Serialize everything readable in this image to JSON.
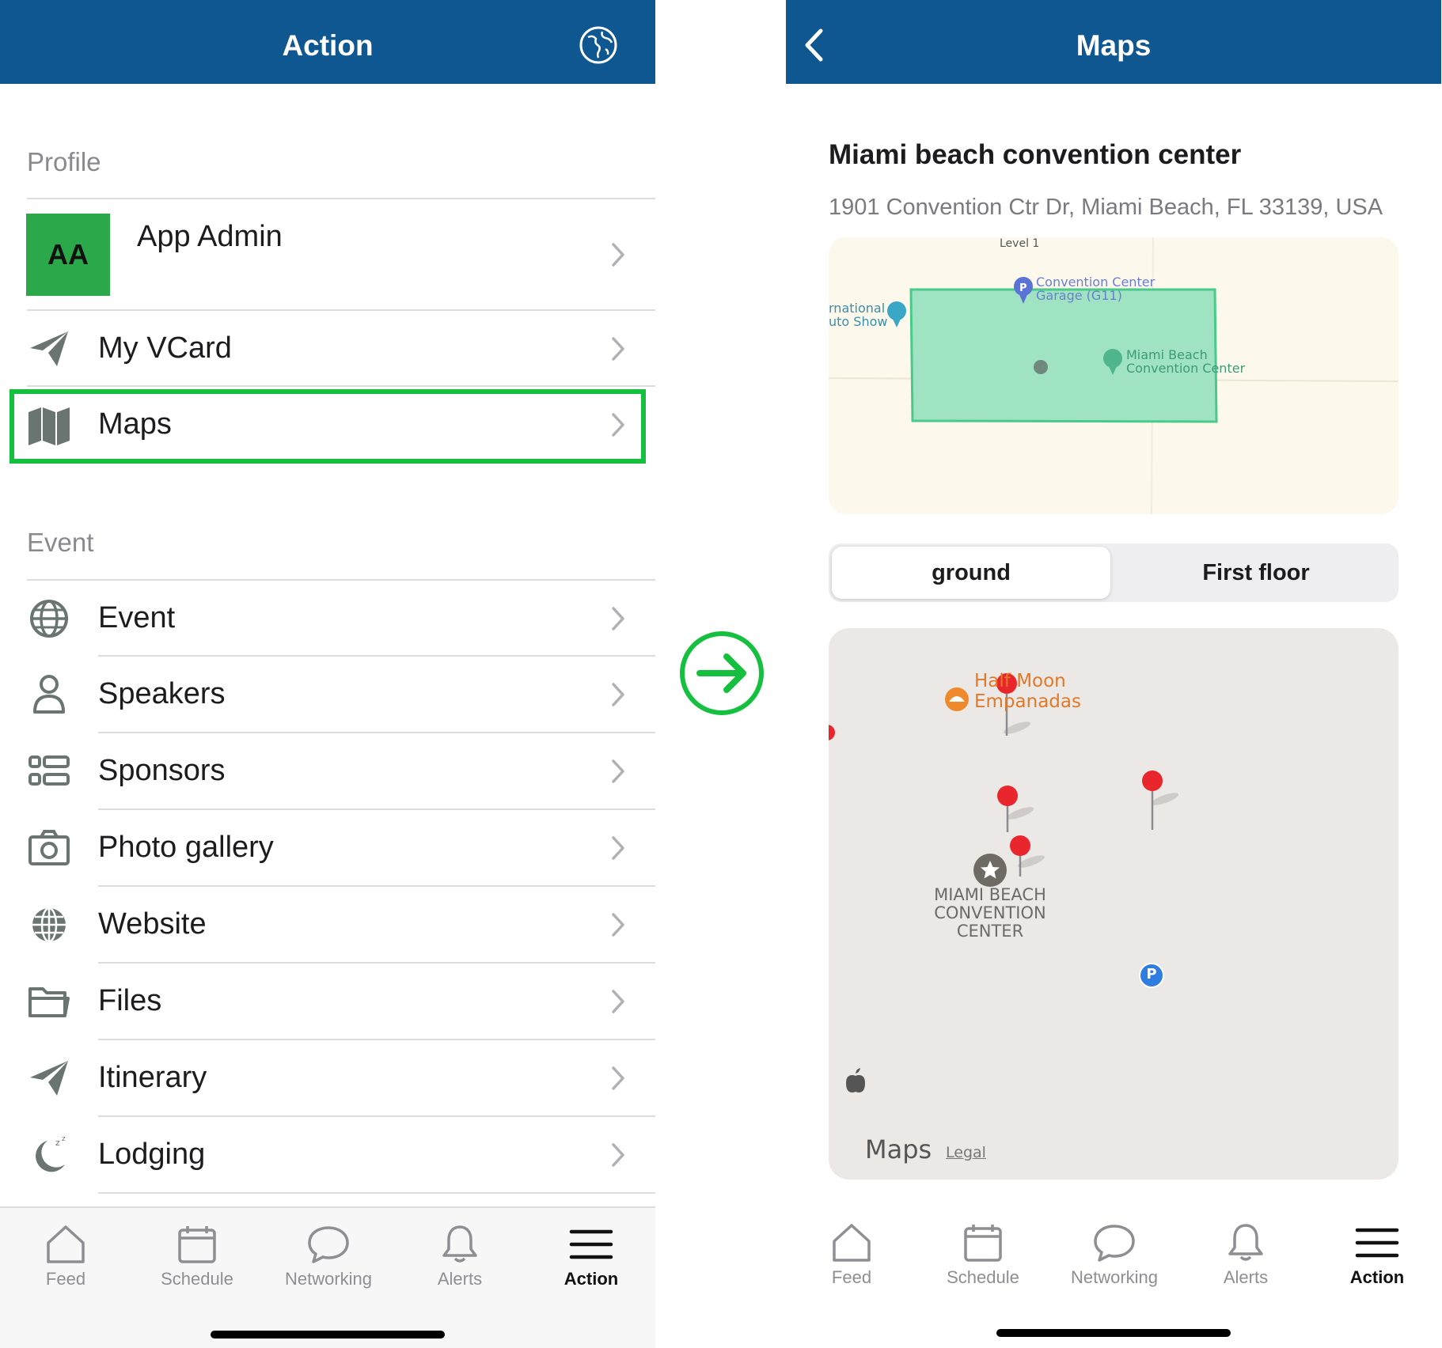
{
  "left": {
    "header": {
      "title": "Action",
      "icon": "globe-icon"
    },
    "profile_section": "Profile",
    "profile": {
      "initials": "AA",
      "name": "App Admin"
    },
    "profile_items": [
      {
        "label": "My VCard",
        "icon": "paper-plane-icon"
      },
      {
        "label": "Maps",
        "icon": "map-icon",
        "highlighted": true
      }
    ],
    "event_section": "Event",
    "event_items": [
      {
        "label": "Event",
        "icon": "globe-icon"
      },
      {
        "label": "Speakers",
        "icon": "person-icon"
      },
      {
        "label": "Sponsors",
        "icon": "list-icon"
      },
      {
        "label": "Photo gallery",
        "icon": "camera-icon"
      },
      {
        "label": "Website",
        "icon": "web-globe-icon"
      },
      {
        "label": "Files",
        "icon": "folder-icon"
      },
      {
        "label": "Itinerary",
        "icon": "paper-plane-icon"
      },
      {
        "label": "Lodging",
        "icon": "moon-icon"
      }
    ]
  },
  "right": {
    "header": {
      "title": "Maps",
      "back_icon": "chevron-left-icon"
    },
    "venue": {
      "name": "Miami beach convention center",
      "address": "1901 Convention Ctr Dr, Miami Beach, FL 33139, USA"
    },
    "floorplan_labels": {
      "level": "Level 1",
      "garage_line1": "Convention Center",
      "garage_line2": "Garage (G11)",
      "intl_line1": "rnational",
      "intl_line2": "uto Show",
      "center_line1": "Miami Beach",
      "center_line2": "Convention Center"
    },
    "floors": [
      "ground",
      "First floor"
    ],
    "selected_floor": "ground",
    "map_labels": {
      "restaurant_line1": "Half Moon",
      "restaurant_line2": "Empanadas",
      "venue_line1": "MIAMI BEACH",
      "venue_line2": "CONVENTION",
      "venue_line3": "CENTER",
      "parking": "P",
      "attribution": "Maps",
      "legal": "Legal"
    }
  },
  "tabs": [
    {
      "label": "Feed",
      "icon": "home-icon"
    },
    {
      "label": "Schedule",
      "icon": "calendar-icon"
    },
    {
      "label": "Networking",
      "icon": "chat-bubble-icon"
    },
    {
      "label": "Alerts",
      "icon": "bell-icon"
    },
    {
      "label": "Action",
      "icon": "hamburger-menu-icon",
      "active": true
    }
  ],
  "colors": {
    "header": "#0f5791",
    "highlight": "#16c03f",
    "avatar": "#2ba84a",
    "pin": "#e8262b"
  }
}
